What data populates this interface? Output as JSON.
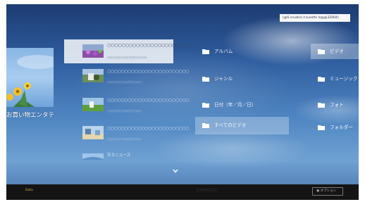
{
  "account_id": "(@6.cruatric.t.tusetts ls@@32004)",
  "featured": {
    "title": "お買い物エンタテ"
  },
  "recent": [
    {
      "title": "○○○○○○○○○○○○○○○○○○○○○○○○",
      "meta": "○○○○○○○○○○/○○○○○",
      "thumb": "flowers"
    },
    {
      "title": "○○○○○○○○○○○○○○○○○○○○○○○○",
      "meta": "○○○○○○○○/○○○○○",
      "thumb": "ride"
    },
    {
      "title": "○○○○○○○○○○○○○○○○○○○○○○○○",
      "meta": "○○○○○○○○/○○○○○",
      "thumb": "field"
    },
    {
      "title": "○○○○○○○○○○○○○○○○○○○○○○○○",
      "meta": "○○○○○○○○/○○○○○",
      "thumb": "beach"
    },
    {
      "title": "ＢＳニュース",
      "meta": "",
      "thumb": "news"
    }
  ],
  "menu_col1": [
    {
      "label": "アルバム"
    },
    {
      "label": "ジャンル"
    },
    {
      "label": "日付（年／月／日）"
    },
    {
      "label": "すべてのビデオ"
    }
  ],
  "menu_col2": [
    {
      "label": "ビデオ"
    },
    {
      "label": "ミュージック"
    },
    {
      "label": "フォト"
    },
    {
      "label": "フォルダー"
    }
  ],
  "bottom": {
    "left_label": "Data",
    "page_indicator": "○○○○○○",
    "option_button": "▣ オプション"
  },
  "colors": {
    "accent": "#d9b04a",
    "bar": "#141414"
  }
}
